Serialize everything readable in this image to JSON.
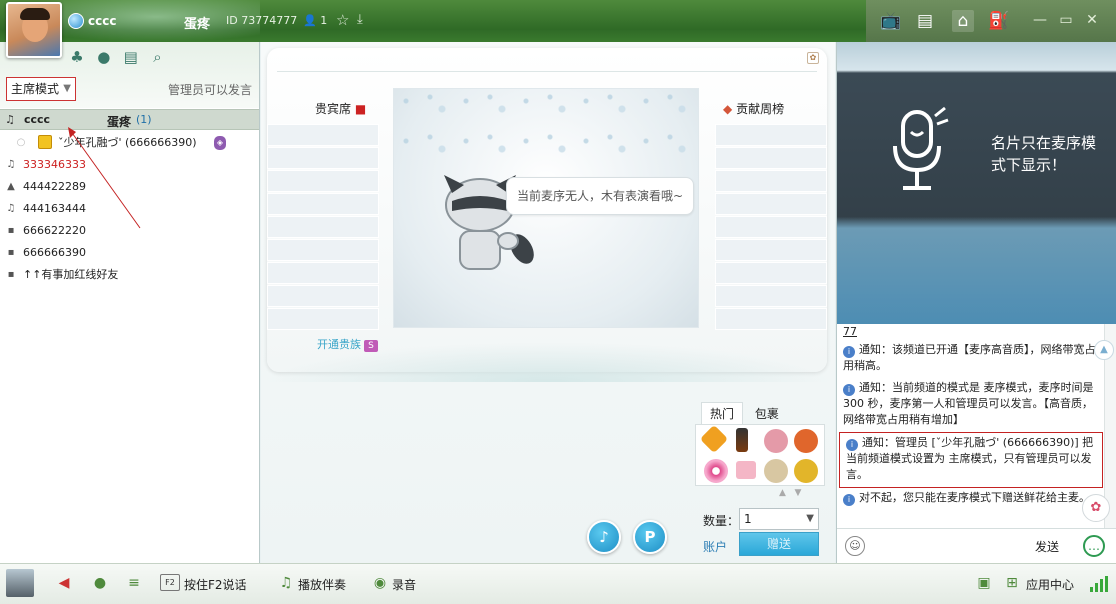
{
  "titlebar": {
    "username": "cccc",
    "channel_name": "蛋疼",
    "channel_id": "ID 73774777",
    "online_count": "1",
    "icons": [
      "tv-icon",
      "list-icon",
      "home-icon",
      "gamepad-icon"
    ],
    "window_buttons": [
      "minimize-icon",
      "restore-icon",
      "close-icon"
    ]
  },
  "left": {
    "mode": "主席模式",
    "mode_hint": "管理员可以发言",
    "channel_row": {
      "user": "cccc",
      "channel": "蛋疼",
      "count": "(1)"
    },
    "users": [
      {
        "text": "ˇ少年孔融づ' (666666390)",
        "kind": "admin"
      },
      {
        "text": "333346333",
        "kind": "red"
      },
      {
        "text": "444422289",
        "kind": "normal"
      },
      {
        "text": "444163444",
        "kind": "normal"
      },
      {
        "text": "666622220",
        "kind": "normal"
      },
      {
        "text": "666666390",
        "kind": "normal"
      },
      {
        "text": "↑↑有事加红线好友",
        "kind": "normal"
      }
    ]
  },
  "center": {
    "guest_title": "贵宾席",
    "contrib_title": "贡献周榜",
    "empty_mic": "当前麦序无人，木有表演看哦~",
    "vip_link": "开通贵族",
    "vip_badge": "S",
    "gift_tabs": [
      "热门",
      "包裹"
    ],
    "qty_label": "数量：",
    "qty_value": "1",
    "account": "账户",
    "give_button": "赠送",
    "round_buttons": [
      "bell-icon",
      "P"
    ]
  },
  "right": {
    "card_text": "名片只在麦序模式下显示！",
    "chat_number": "77",
    "messages": [
      {
        "text": "通知：该频道已开通【麦序高音质】，网络带宽占用稍高。",
        "highlight": false
      },
      {
        "text": "通知：当前频道的模式是 麦序模式，麦序时间是 300 秒，麦序第一人和管理员可以发言。【高音质，网络带宽占用稍有增加】",
        "highlight": false
      },
      {
        "text": "通知：管理员 [ˇ少年孔融づ' (666666390)] 把当前频道模式设置为 主席模式，只有管理员可以发言。",
        "highlight": true
      },
      {
        "text": "对不起，您只能在麦序模式下赠送鲜花给主麦。",
        "highlight": false
      }
    ],
    "send_button": "发送"
  },
  "bottom": {
    "f2_key": "F2",
    "ptt_label": "按住F2说话",
    "accompany_label": "播放伴奏",
    "record_label": "录音",
    "app_center": "应用中心"
  },
  "colors": {
    "titlebar": "#2f6a26",
    "accent_blue": "#2aa7d8",
    "highlight_red": "#c42222"
  }
}
